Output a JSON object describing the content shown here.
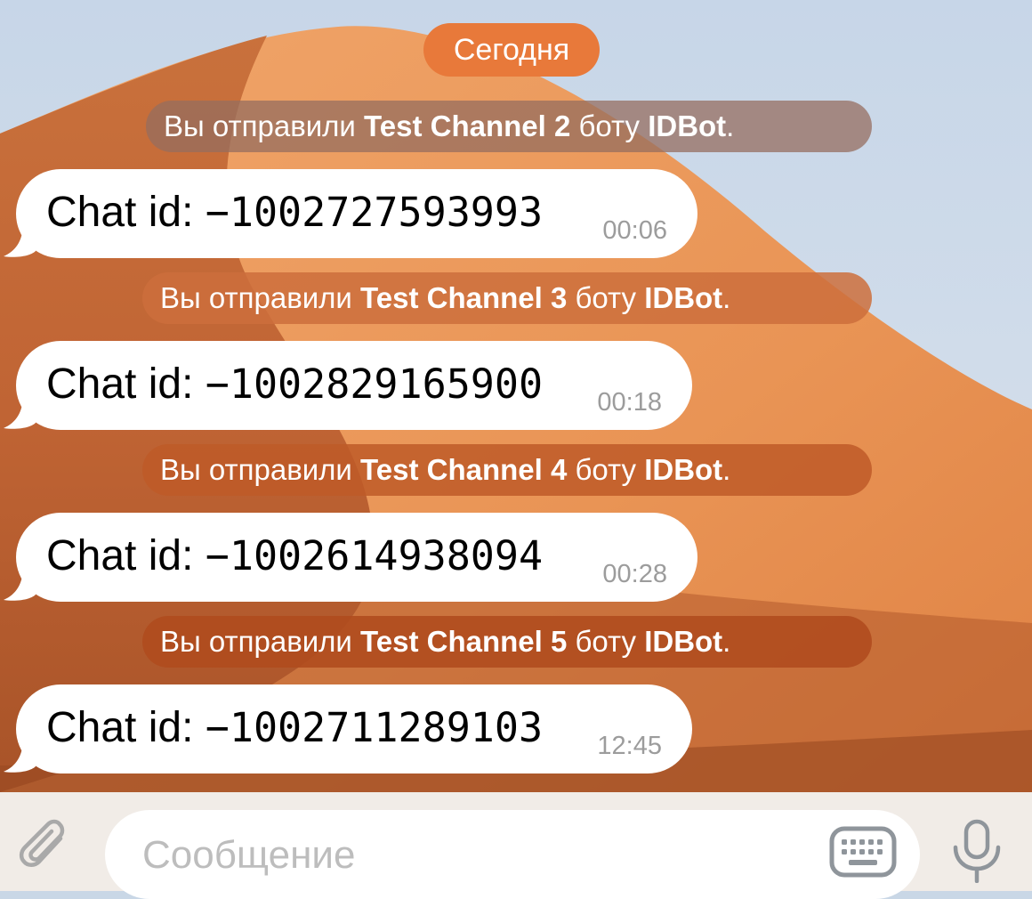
{
  "chat": {
    "date_label": "Сегодня",
    "messages": [
      {
        "service": {
          "prefix": "Вы отправили ",
          "channel": "Test Channel 2",
          "middle": " боту ",
          "bot": "IDBot",
          "suffix": "."
        },
        "bubble": {
          "label": "Chat id: ",
          "value": "−1002727593993",
          "time": "00:06"
        }
      },
      {
        "service": {
          "prefix": "Вы отправили ",
          "channel": "Test Channel 3",
          "middle": " боту ",
          "bot": "IDBot",
          "suffix": "."
        },
        "bubble": {
          "label": "Chat id: ",
          "value": "−1002829165900",
          "time": "00:18"
        }
      },
      {
        "service": {
          "prefix": "Вы отправили ",
          "channel": "Test Channel 4",
          "middle": " боту ",
          "bot": "IDBot",
          "suffix": "."
        },
        "bubble": {
          "label": "Chat id: ",
          "value": "−1002614938094",
          "time": "00:28"
        }
      },
      {
        "service": {
          "prefix": "Вы отправили ",
          "channel": "Test Channel 5",
          "middle": " боту ",
          "bot": "IDBot",
          "suffix": "."
        },
        "bubble": {
          "label": "Chat id: ",
          "value": "−1002711289103",
          "time": "12:45"
        }
      }
    ]
  },
  "composer": {
    "placeholder": "Сообщение",
    "attach_icon": "paperclip-icon",
    "keyboard_icon": "keyboard-icon",
    "mic_icon": "microphone-icon"
  },
  "colors": {
    "date_pill": "#e8793a",
    "bubble": "#ffffff",
    "timestamp": "#9c9c9c"
  }
}
